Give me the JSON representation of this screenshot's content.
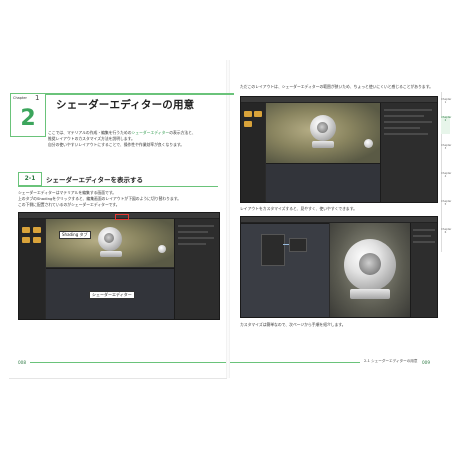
{
  "chapter": {
    "label": "Chapter",
    "number_small": "1",
    "number_big": "2",
    "title": "シェーダーエディターの用意"
  },
  "intro": [
    "ここでは、マテリアルの作成・編集を行うためのシェーダーエディターの表示方法と、",
    "推奨レイアウトのカスタマイズ方法を説明します。",
    "自分の使いやすいレイアウトにすることで、操作性や作業効率が良くなります。"
  ],
  "intro_highlight": "シェーダーエディター",
  "section": {
    "number": "2-1",
    "title": "シェーダーエディターを表示する",
    "body": [
      "シェーダーエディターはマテリアルを編集する画面です。",
      "上のタブのShadingをクリックすると、編集画面のレイアウトが下図のように切り替わります。",
      "この下側に配置されているのがシェーダーエディターです。"
    ]
  },
  "screenshot_left": {
    "callout_tab": "Shading タブ",
    "callout_editor": "シェーダーエディター"
  },
  "right_page": {
    "caption_top": "ただこのレイアウトは、シェーダーエディターの範囲が狭いため、ちょっと使いにくいと感じることがあります。",
    "caption_mid": "レイアウトをカスタマイズすると、見やすく、使いやすくできます。",
    "caption_bottom": "カスタマイズは簡単なので、次ページから手順を紹介します。"
  },
  "side_tabs": [
    "Chapter 1",
    "Chapter 2",
    "Chapter 3",
    "Chapter 4",
    "Chapter 5",
    "Chapter 6"
  ],
  "folio_left": "008",
  "folio_right": "009",
  "running_head": "2-1 シェーダーエディターの用意"
}
